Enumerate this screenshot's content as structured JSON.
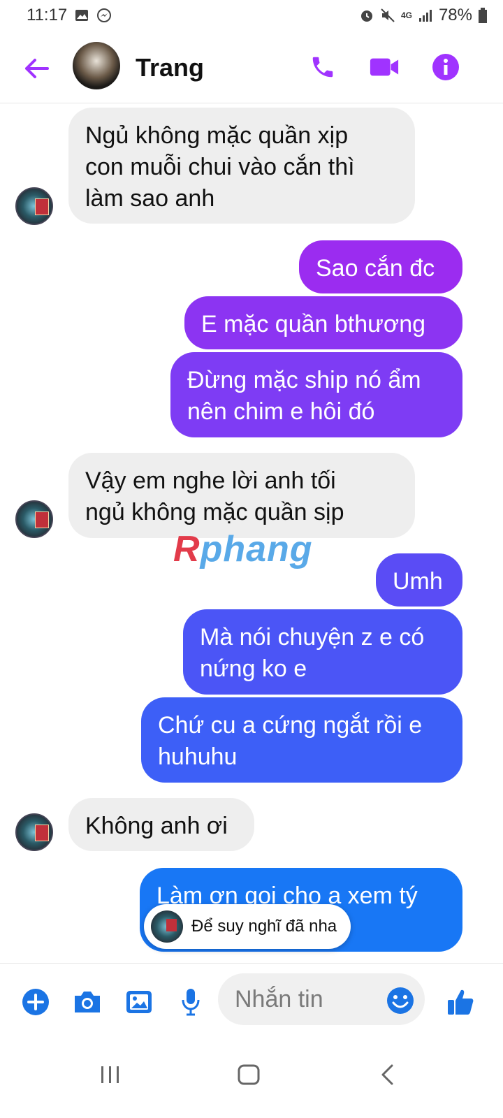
{
  "status_bar": {
    "time": "11:17",
    "battery": "78%",
    "network": "4G"
  },
  "header": {
    "contact_name": "Trang",
    "accent_color": "#a033ff"
  },
  "messages": [
    {
      "side": "in",
      "text": "Ngủ không mặc quần xịp\ncon muỗi chui vào cắn thì\nlàm sao anh"
    },
    {
      "side": "out",
      "text": "Sao cắn đc",
      "color": "#9b2cf0"
    },
    {
      "side": "out",
      "text": "E mặc quần bthương",
      "color": "#8c34f2"
    },
    {
      "side": "out",
      "text": "Đừng mặc ship nó ẩm\nnên chim e hôi đó",
      "color": "#7e3cf4"
    },
    {
      "side": "in",
      "text": "Vậy em nghe lời anh tối\nngủ không mặc quần sịp"
    },
    {
      "side": "out",
      "text": "Umh",
      "color": "#5a4cf5"
    },
    {
      "side": "out",
      "text": "Mà nói chuyện z e có\nnứng ko e",
      "color": "#4b55f6"
    },
    {
      "side": "out",
      "text": "Chứ cu a cứng ngắt rồi e\nhuhuhu",
      "color": "#3d5ff7"
    },
    {
      "side": "in",
      "text": "Không anh ơi"
    },
    {
      "side": "out",
      "text": "Làm ơn gọi cho a xem tý",
      "color": "#1877f5"
    }
  ],
  "watermark": {
    "part1": "R",
    "part2": "phang"
  },
  "typing_preview": {
    "text": "Để suy nghĩ đã nha"
  },
  "composer": {
    "placeholder": "Nhắn tin"
  }
}
